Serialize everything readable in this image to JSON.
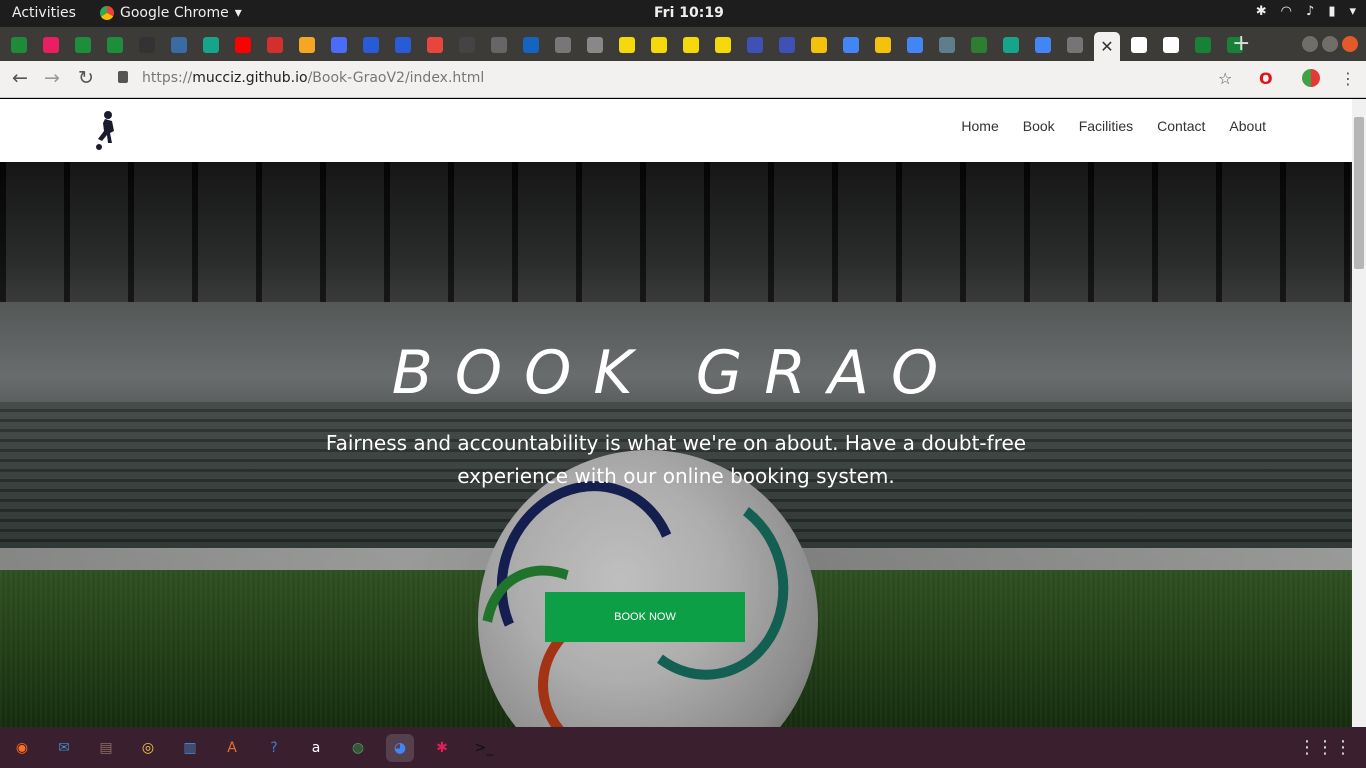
{
  "system": {
    "activities_label": "Activities",
    "app_menu_label": "Google Chrome",
    "clock": "Fri 10:19"
  },
  "browser": {
    "url_scheme": "https://",
    "url_host": "mucciz.github.io",
    "url_path": "/Book-GraoV2/index.html",
    "tab_favicons": [
      "#1f8a3b",
      "#e91e63",
      "#1e8e3e",
      "#1e8e3e",
      "#333333",
      "#3b6ba5",
      "#17a589",
      "#ff0000",
      "#d32f2f",
      "#f5a623",
      "#4a6cf7",
      "#2a5bd7",
      "#2a5bd7",
      "#e8453c",
      "#444444",
      "#666666",
      "#1565c0",
      "#777777",
      "#888888",
      "#f5d90a",
      "#f5d90a",
      "#f5d90a",
      "#f5d90a",
      "#3f51b5",
      "#3f51b5",
      "#f4c20d",
      "#4285f4",
      "#f4c20d",
      "#4285f4",
      "#607d8b",
      "#2e7d32",
      "#17a589",
      "#4285f4",
      "#757575",
      "#ffffff",
      "#ffffff",
      "#188038",
      "#188038"
    ],
    "active_tab_close": "✕"
  },
  "site": {
    "nav": [
      "Home",
      "Book",
      "Facilities",
      "Contact",
      "About"
    ],
    "hero_title": "BOOK GRAO",
    "hero_subtitle": "Fairness and accountability is what we're on about. Have a doubt-free experience with our online booking system.",
    "cta_label": "BOOK NOW",
    "accent_color": "#0d9f45"
  },
  "dock": {
    "apps": [
      "firefox-icon",
      "thunderbird-icon",
      "files-icon",
      "rhythmbox-icon",
      "writer-icon",
      "software-icon",
      "help-icon",
      "amazon-icon",
      "mailspring-icon",
      "chrome-icon",
      "slack-icon",
      "terminal-icon"
    ]
  }
}
